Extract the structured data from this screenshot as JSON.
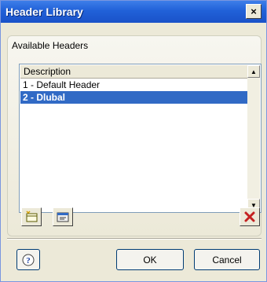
{
  "window": {
    "title": "Header Library",
    "close_label": "×"
  },
  "group": {
    "label": "Available Headers"
  },
  "list": {
    "column_header": "Description",
    "rows": [
      {
        "label": "1 - Default Header"
      },
      {
        "label": "2 - Dlubal",
        "selected": true
      }
    ]
  },
  "toolbar": {
    "new_icon": "new-header-icon",
    "edit_icon": "edit-header-icon",
    "delete_icon": "delete-icon"
  },
  "buttons": {
    "ok_label": "OK",
    "cancel_label": "Cancel",
    "help_icon": "help-icon"
  },
  "colors": {
    "title_bar": "#2161d8",
    "selection": "#316ac5",
    "delete_red": "#c42121"
  }
}
